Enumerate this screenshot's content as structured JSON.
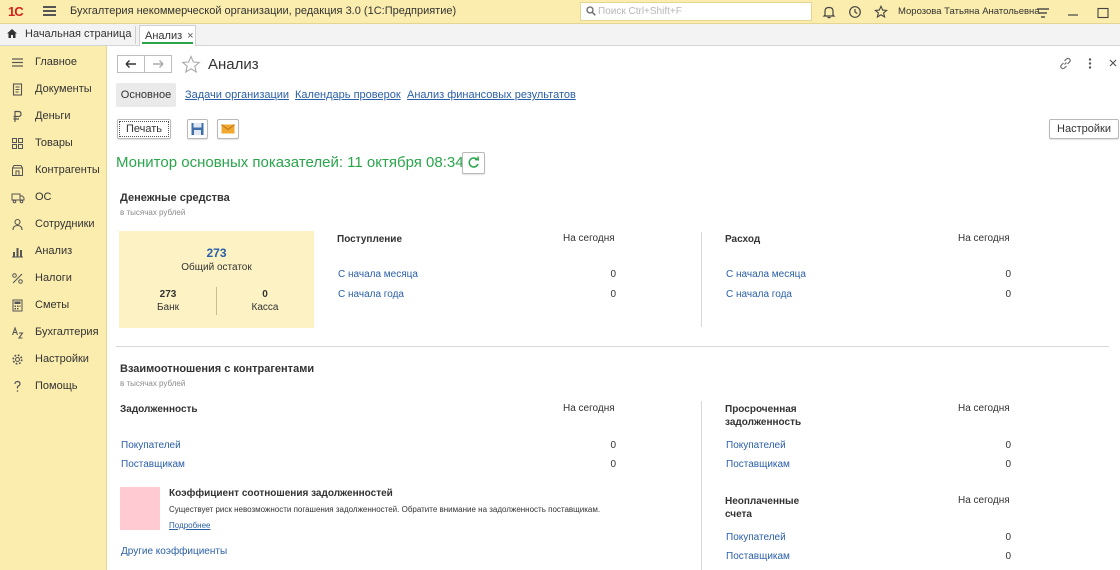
{
  "titlebar": {
    "logo": "1С",
    "app_title": "Бухгалтерия некоммерческой организации, редакция 3.0  (1С:Предприятие)",
    "search_placeholder": "Поиск Ctrl+Shift+F",
    "user": "Морозова Татьяна Анатольевна"
  },
  "tabs": {
    "home": "Начальная страница",
    "active": "Анализ",
    "close_glyph": "×"
  },
  "sidebar": {
    "items": [
      {
        "label": "Главное",
        "icon": "menu-icon"
      },
      {
        "label": "Документы",
        "icon": "document-icon"
      },
      {
        "label": "Деньги",
        "icon": "ruble-icon"
      },
      {
        "label": "Товары",
        "icon": "goods-icon"
      },
      {
        "label": "Контрагенты",
        "icon": "contractors-icon"
      },
      {
        "label": "ОС",
        "icon": "truck-icon"
      },
      {
        "label": "Сотрудники",
        "icon": "person-icon"
      },
      {
        "label": "Анализ",
        "icon": "chart-icon"
      },
      {
        "label": "Налоги",
        "icon": "percent-icon"
      },
      {
        "label": "Сметы",
        "icon": "calculator-icon"
      },
      {
        "label": "Бухгалтерия",
        "icon": "accounting-icon"
      },
      {
        "label": "Настройки",
        "icon": "gear-icon"
      },
      {
        "label": "Помощь",
        "icon": "question-icon"
      }
    ]
  },
  "page": {
    "title": "Анализ",
    "subtabs": [
      "Основное",
      "Задачи организации",
      "Календарь проверок",
      "Анализ финансовых результатов"
    ],
    "print_label": "Печать",
    "settings_label": "Настройки",
    "monitor_title": "Монитор основных показателей: 11 октября 08:34"
  },
  "cash": {
    "title": "Денежные средства",
    "subtitle": "в тысячах рублей",
    "total": "273",
    "total_label": "Общий остаток",
    "bank_value": "273",
    "bank_label": "Банк",
    "cashbox_value": "0",
    "cashbox_label": "Касса",
    "income": {
      "header": "Поступление",
      "col": "На сегодня",
      "rows": [
        {
          "label": "С начала месяца",
          "value": "0"
        },
        {
          "label": "С начала года",
          "value": "0"
        }
      ]
    },
    "expense": {
      "header": "Расход",
      "col": "На сегодня",
      "rows": [
        {
          "label": "С начала месяца",
          "value": "0"
        },
        {
          "label": "С начала года",
          "value": "0"
        }
      ]
    }
  },
  "relations": {
    "title": "Взаимоотношения с контрагентами",
    "subtitle": "в тысячах рублей",
    "debt": {
      "header": "Задолженность",
      "col": "На сегодня",
      "rows": [
        {
          "label": "Покупателей",
          "value": "0"
        },
        {
          "label": "Поставщикам",
          "value": "0"
        }
      ]
    },
    "overdue": {
      "header_line1": "Просроченная",
      "header_line2": "задолженность",
      "col": "На сегодня",
      "rows": [
        {
          "label": "Покупателей",
          "value": "0"
        },
        {
          "label": "Поставщикам",
          "value": "0"
        }
      ]
    },
    "unpaid": {
      "header_line1": "Неоплаченные",
      "header_line2": "счета",
      "col": "На сегодня",
      "rows": [
        {
          "label": "Покупателей",
          "value": "0"
        },
        {
          "label": "Поставщикам",
          "value": "0"
        }
      ]
    },
    "ratio": {
      "title": "Коэффициент соотношения задолженностей",
      "text": "Существует риск невозможности погашения задолженностей. Обратите внимание на задолженность поставщикам.",
      "more": "Подробнее",
      "indicator_color": "#ffcad2"
    },
    "other_ratios": "Другие коэффициенты"
  },
  "colors": {
    "accent_yellow": "#fbedad",
    "card_yellow": "#fcf2c4",
    "link": "#2a5fa8",
    "monitor_green": "#2aa54b",
    "brand_red": "#d6231c"
  }
}
